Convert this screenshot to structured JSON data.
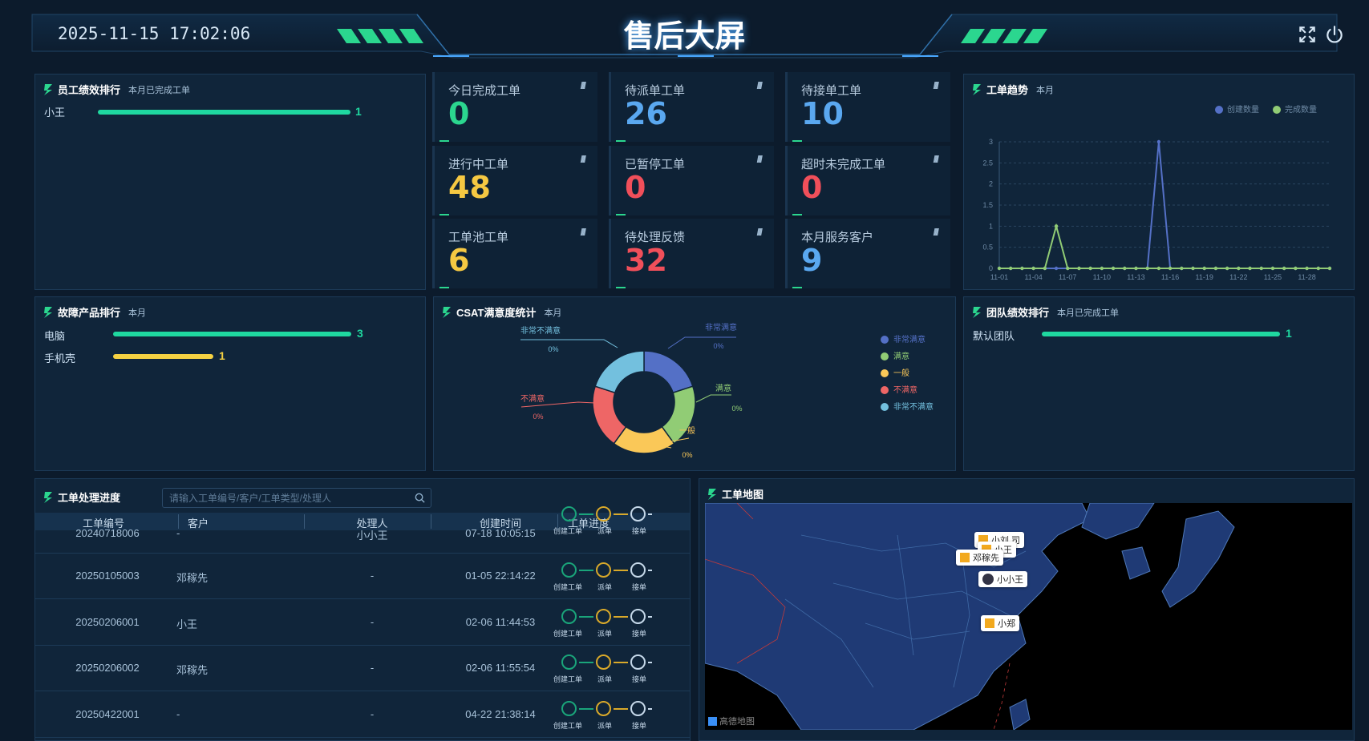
{
  "header": {
    "clock": "2025-11-15 17:02:06",
    "title": "售后大屏"
  },
  "employee_rank": {
    "title": "员工绩效排行",
    "subtitle": "本月已完成工单",
    "items": [
      {
        "name": "小王",
        "value": "1",
        "fraction": 1.0,
        "color": "#1fd8a0"
      }
    ]
  },
  "stats": [
    {
      "label": "今日完成工单",
      "value": "0",
      "color": "#2bd68f"
    },
    {
      "label": "待派单工单",
      "value": "26",
      "color": "#5aa8f0"
    },
    {
      "label": "待接单工单",
      "value": "10",
      "color": "#5aa8f0"
    },
    {
      "label": "进行中工单",
      "value": "48",
      "color": "#f5c842"
    },
    {
      "label": "已暂停工单",
      "value": "0",
      "color": "#f04f5a"
    },
    {
      "label": "超时未完成工单",
      "value": "0",
      "color": "#f04f5a"
    },
    {
      "label": "工单池工单",
      "value": "6",
      "color": "#f5c842"
    },
    {
      "label": "待处理反馈",
      "value": "32",
      "color": "#f04f5a"
    },
    {
      "label": "本月服务客户",
      "value": "9",
      "color": "#5aa8f0"
    }
  ],
  "trend": {
    "title": "工单趋势",
    "subtitle": "本月",
    "legend": [
      {
        "name": "创建数量",
        "color": "#5470c6"
      },
      {
        "name": "完成数量",
        "color": "#91cc75"
      }
    ]
  },
  "chart_data": {
    "type": "line",
    "x": [
      "11-01",
      "11-02",
      "11-03",
      "11-04",
      "11-05",
      "11-06",
      "11-07",
      "11-08",
      "11-09",
      "11-10",
      "11-11",
      "11-12",
      "11-13",
      "11-14",
      "11-15",
      "11-16",
      "11-17",
      "11-18",
      "11-19",
      "11-20",
      "11-21",
      "11-22",
      "11-23",
      "11-24",
      "11-25",
      "11-26",
      "11-27",
      "11-28",
      "11-29",
      "11-30"
    ],
    "xticks": [
      "11-01",
      "11-04",
      "11-07",
      "11-10",
      "11-13",
      "11-16",
      "11-19",
      "11-22",
      "11-25",
      "11-28"
    ],
    "yticks": [
      "0",
      "0.5",
      "1",
      "1.5",
      "2",
      "2.5",
      "3"
    ],
    "ylim": [
      0,
      3
    ],
    "series": [
      {
        "name": "创建数量",
        "color": "#5470c6",
        "values": [
          0,
          0,
          0,
          0,
          0,
          0,
          0,
          0,
          0,
          0,
          0,
          0,
          0,
          0,
          3,
          0,
          0,
          0,
          0,
          0,
          0,
          0,
          0,
          0,
          0,
          0,
          0,
          0,
          0,
          0
        ]
      },
      {
        "name": "完成数量",
        "color": "#91cc75",
        "values": [
          0,
          0,
          0,
          0,
          0,
          1,
          0,
          0,
          0,
          0,
          0,
          0,
          0,
          0,
          0,
          0,
          0,
          0,
          0,
          0,
          0,
          0,
          0,
          0,
          0,
          0,
          0,
          0,
          0,
          0
        ]
      }
    ],
    "grid": true
  },
  "fault_rank": {
    "title": "故障产品排行",
    "subtitle": "本月",
    "items": [
      {
        "name": "电脑",
        "value": "3",
        "fraction": 1.0,
        "color": "#1fd8a0"
      },
      {
        "name": "手机壳",
        "value": "1",
        "fraction": 0.42,
        "color": "#f5d142"
      }
    ]
  },
  "csat": {
    "title": "CSAT满意度统计",
    "subtitle": "本月",
    "slices": [
      {
        "name": "非常满意",
        "pct": "0%",
        "color": "#5470c6"
      },
      {
        "name": "满意",
        "pct": "0%",
        "color": "#91cc75"
      },
      {
        "name": "一般",
        "pct": "0%",
        "color": "#fac858"
      },
      {
        "name": "不满意",
        "pct": "0%",
        "color": "#ee6666"
      },
      {
        "name": "非常不满意",
        "pct": "0%",
        "color": "#73c0de"
      }
    ]
  },
  "team_rank": {
    "title": "团队绩效排行",
    "subtitle": "本月已完成工单",
    "items": [
      {
        "name": "默认团队",
        "value": "1",
        "fraction": 1.0,
        "color": "#1fd8a0"
      }
    ]
  },
  "orders": {
    "title": "工单处理进度",
    "search_placeholder": "请输入工单编号/客户/工单类型/处理人",
    "columns": [
      "工单编号",
      "客户",
      "处理人",
      "创建时间",
      "工单进度"
    ],
    "steps": [
      "创建工单",
      "派单",
      "接单"
    ],
    "rows": [
      {
        "id": "20240718006",
        "customer": "-",
        "handler": "小小王",
        "time": "07-18 10:05:15"
      },
      {
        "id": "20250105003",
        "customer": "邓稼先",
        "handler": "-",
        "time": "01-05 22:14:22"
      },
      {
        "id": "20250206001",
        "customer": "小王",
        "handler": "-",
        "time": "02-06 11:44:53"
      },
      {
        "id": "20250206002",
        "customer": "邓稼先",
        "handler": "-",
        "time": "02-06 11:55:54"
      },
      {
        "id": "20250422001",
        "customer": "-",
        "handler": "-",
        "time": "04-22 21:38:14"
      }
    ]
  },
  "map": {
    "title": "工单地图",
    "pins": [
      "小刘 司",
      "小王",
      "邓稼先",
      "小小王",
      "小郑"
    ],
    "credit": "高德地图"
  }
}
